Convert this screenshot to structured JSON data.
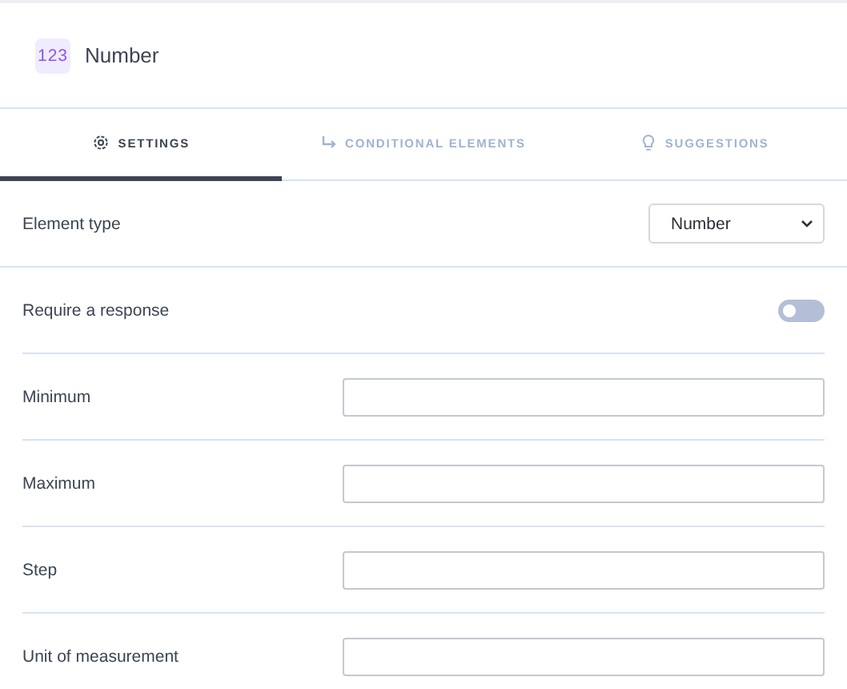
{
  "header": {
    "badge": "123",
    "title": "Number"
  },
  "tabs": [
    {
      "label": "SETTINGS",
      "selected": true
    },
    {
      "label": "CONDITIONAL ELEMENTS",
      "selected": false
    },
    {
      "label": "SUGGESTIONS",
      "selected": false
    }
  ],
  "fields": [
    {
      "kind": "select",
      "label": "Element type",
      "value": "Number"
    },
    {
      "kind": "toggle",
      "label": "Require a response",
      "on": false
    },
    {
      "kind": "input",
      "label": "Minimum"
    },
    {
      "kind": "input",
      "label": "Maximum"
    },
    {
      "kind": "input",
      "label": "Step"
    },
    {
      "kind": "input",
      "label": "Unit of measurement"
    }
  ]
}
